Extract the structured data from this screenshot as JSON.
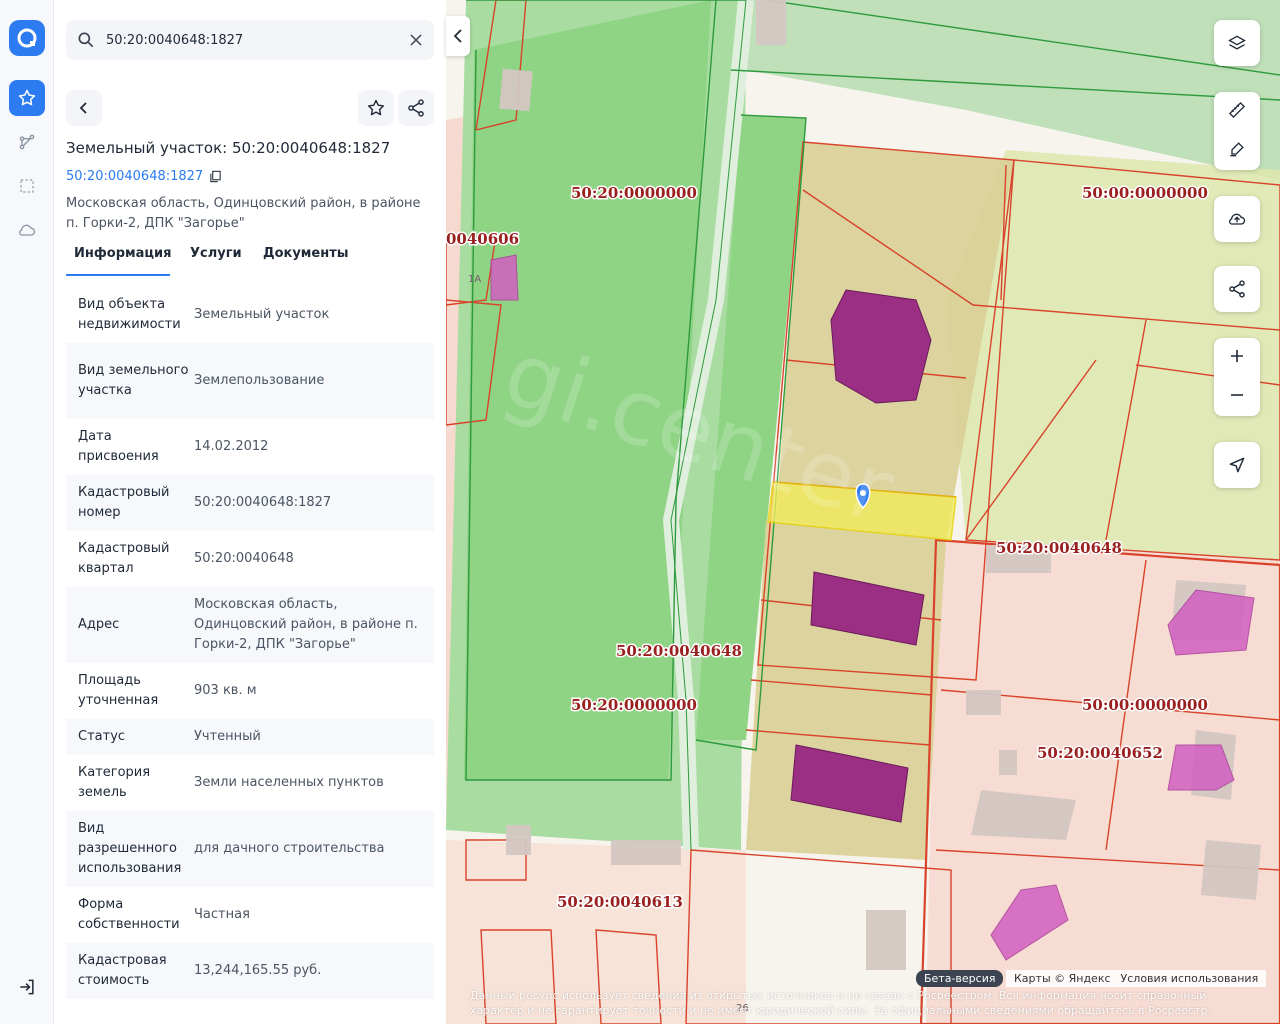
{
  "search": {
    "value": "50:20:0040648:1827"
  },
  "object": {
    "title": "Земельный участок: 50:20:0040648:1827",
    "cad_number_link": "50:20:0040648:1827",
    "address": "Московская область, Одинцовский район, в районе п. Горки-2, ДПК \"Загорье\""
  },
  "tabs": [
    {
      "label": "Информация"
    },
    {
      "label": "Услуги"
    },
    {
      "label": "Документы"
    }
  ],
  "info": [
    {
      "key": "Вид объекта недвижимости",
      "value": "Земельный участок"
    },
    {
      "key": "Вид земельного участка",
      "value": "Землепользование"
    },
    {
      "key": "Дата присвоения",
      "value": "14.02.2012"
    },
    {
      "key": "Кадастровый номер",
      "value": "50:20:0040648:1827"
    },
    {
      "key": "Кадастровый квартал",
      "value": "50:20:0040648"
    },
    {
      "key": "Адрес",
      "value": "Московская область, Одинцовский район, в районе п. Горки-2, ДПК \"Загорье\""
    },
    {
      "key": "Площадь уточненная",
      "value": "903 кв. м"
    },
    {
      "key": "Статус",
      "value": "Учтенный"
    },
    {
      "key": "Категория земель",
      "value": "Земли населенных пунктов"
    },
    {
      "key": "Вид разрешенного использования",
      "value": "для дачного строительства"
    },
    {
      "key": "Форма собственности",
      "value": "Частная"
    },
    {
      "key": "Кадастровая стоимость",
      "value": "13,244,165.55 руб."
    }
  ],
  "map": {
    "labels": {
      "l1": "50:20:0000000",
      "l2": "50:00:0000000",
      "l3": "0040606",
      "l4": "50:20:0040648",
      "l5": "50:20:0040648",
      "l6": "50:20:0000000",
      "l7": "50:00:0000000",
      "l8": "50:20:0040652",
      "l9": "50:20:0040613"
    },
    "small_numbers": {
      "n1": "1А",
      "n2": "26"
    },
    "watermark": "gi.center"
  },
  "footer": {
    "beta": "Бета-версия",
    "maps": "Карты © Яндекс",
    "terms": "Условия использования",
    "disclaimer": "Данный ресурс использует сведения из открытых источников и не связан с Росреестром. Вся информация носит справочный характер и не гарантирует точности и не имеет юридической силы. За официальными сведениями обращайтесь в Росреестр."
  },
  "colors": {
    "accent": "#2c7bf0",
    "parcel_line": "#d8432a",
    "building": "#9a2f84",
    "selected": "#f0ea5a"
  }
}
